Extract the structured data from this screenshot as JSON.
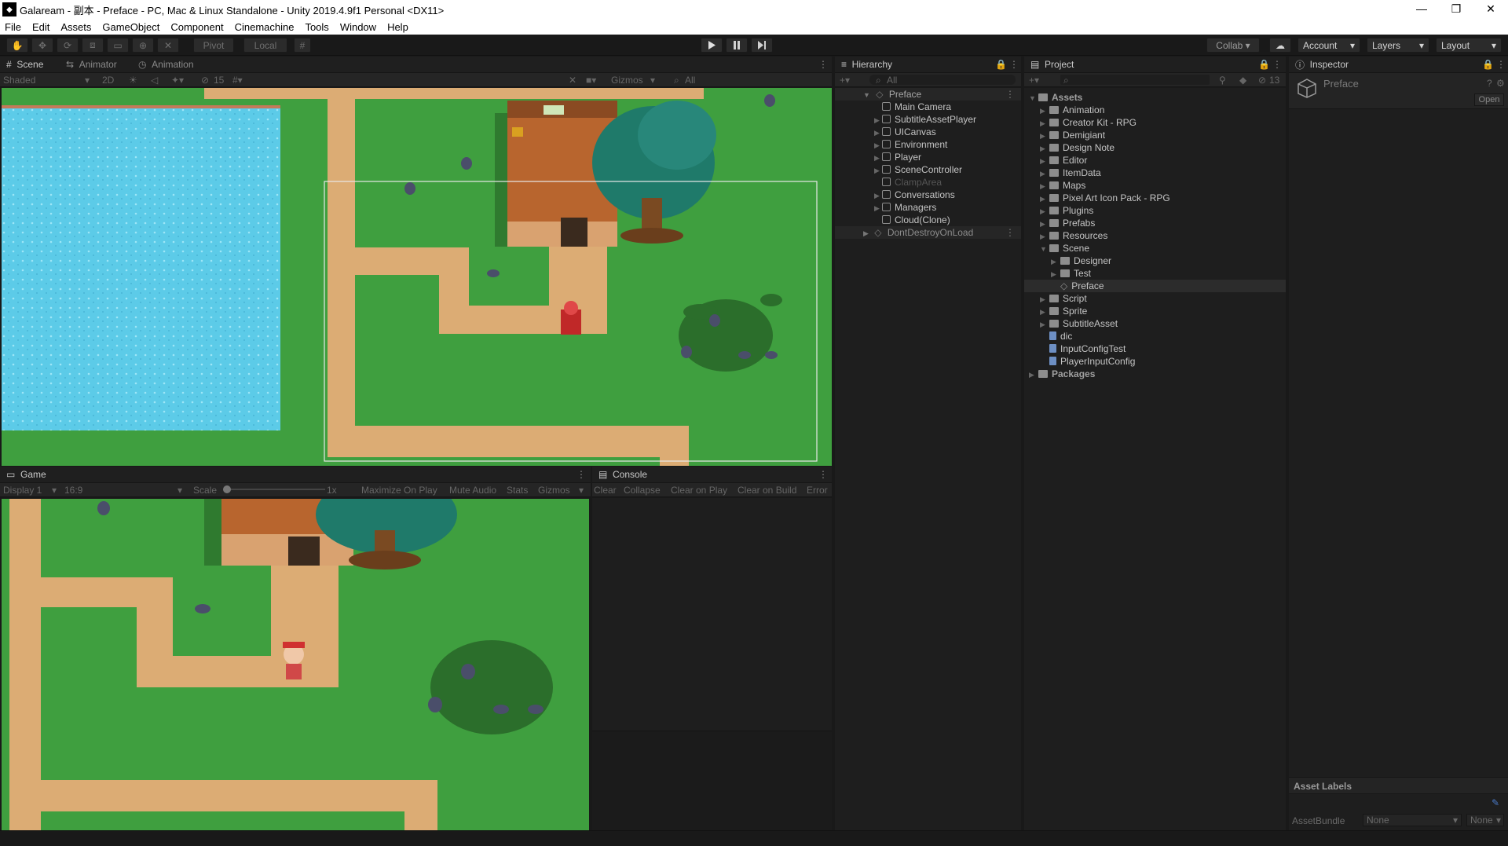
{
  "window": {
    "title": "Galaream - 副本 - Preface - PC, Mac & Linux Standalone - Unity 2019.4.9f1 Personal <DX11>",
    "minimize": "—",
    "restore": "❐",
    "close": "✕"
  },
  "menu": [
    "File",
    "Edit",
    "Assets",
    "GameObject",
    "Component",
    "Cinemachine",
    "Tools",
    "Window",
    "Help"
  ],
  "toolbar": {
    "pivot": "Pivot",
    "local": "Local",
    "collab": "Collab",
    "account": "Account",
    "layers": "Layers",
    "layout": "Layout"
  },
  "scene": {
    "tabs": [
      "Scene",
      "Animator",
      "Animation"
    ],
    "shading": "Shaded",
    "mode2d": "2D",
    "hidden_count": "15",
    "gizmos": "Gizmos",
    "search": "All"
  },
  "game": {
    "tab": "Game",
    "display": "Display 1",
    "aspect": "16:9",
    "scale_label": "Scale",
    "scale_value": "1x",
    "maximize": "Maximize On Play",
    "mute": "Mute Audio",
    "stats": "Stats",
    "gizmos": "Gizmos"
  },
  "console": {
    "tab": "Console",
    "clear": "Clear",
    "collapse": "Collapse",
    "clear_on_play": "Clear on Play",
    "clear_on_build": "Clear on Build",
    "error": "Error"
  },
  "hierarchy": {
    "tab": "Hierarchy",
    "search": "All",
    "scene_name": "Preface",
    "items": [
      "Main Camera",
      "SubtitleAssetPlayer",
      "UICanvas",
      "Environment",
      "Player",
      "SceneController",
      "ClampArea",
      "Conversations",
      "Managers",
      "Cloud(Clone)"
    ],
    "dontdestroy": "DontDestroyOnLoad"
  },
  "project": {
    "tab": "Project",
    "hidden_count": "13",
    "root": "Assets",
    "folders": [
      "Animation",
      "Creator Kit - RPG",
      "Demigiant",
      "Design Note",
      "Editor",
      "ItemData",
      "Maps",
      "Pixel Art Icon Pack - RPG",
      "Plugins",
      "Prefabs",
      "Resources"
    ],
    "scene_folder": "Scene",
    "scene_children": [
      "Designer",
      "Test"
    ],
    "scene_file": "Preface",
    "after": [
      "Script",
      "Sprite",
      "SubtitleAsset"
    ],
    "files": [
      "dic",
      "InputConfigTest",
      "PlayerInputConfig"
    ],
    "packages": "Packages"
  },
  "inspector": {
    "tab": "Inspector",
    "asset_name": "Preface",
    "open_button": "Open",
    "asset_labels": "Asset Labels",
    "asset_bundle_label": "AssetBundle",
    "bundle_value": "None",
    "variant_value": "None"
  },
  "colors": {
    "grass": "#3f9f3f",
    "path": "#dcac74",
    "water": "#5ccbe8",
    "editor_bg": "#1e1e1e",
    "selected_row": "#2c2c2c"
  }
}
